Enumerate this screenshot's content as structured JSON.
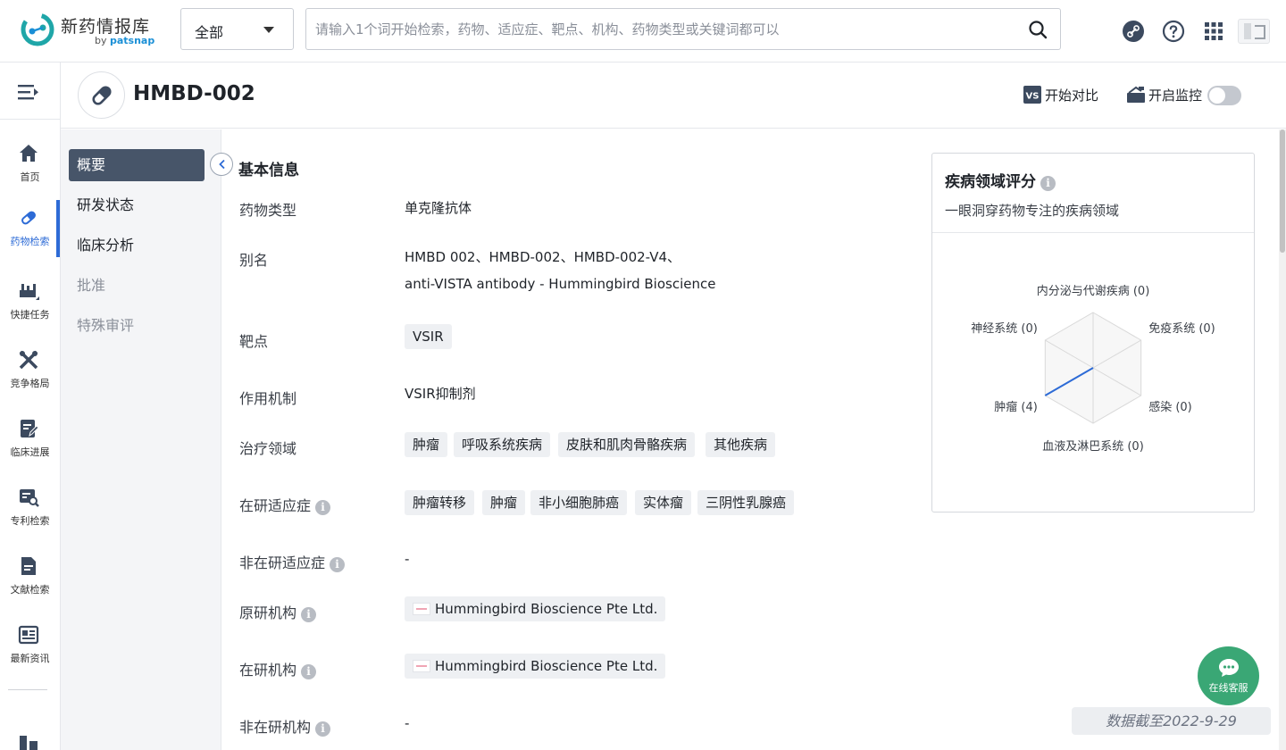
{
  "brand": {
    "title": "新药情报库",
    "sub_prefix": "by",
    "sub_brand": "patsnap"
  },
  "search": {
    "scope": "全部",
    "placeholder": "请输入1个词开始检索，药物、适应症、靶点、机构、药物类型或关键词都可以"
  },
  "sidebar": {
    "items": [
      {
        "label": "首页",
        "icon": "home-icon"
      },
      {
        "label": "药物检索",
        "icon": "pill-icon",
        "active": true
      },
      {
        "label": "快捷任务",
        "icon": "task-icon"
      },
      {
        "label": "竞争格局",
        "icon": "crossed-tools-icon"
      },
      {
        "label": "临床进展",
        "icon": "clipboard-edit-icon"
      },
      {
        "label": "专利检索",
        "icon": "patent-search-icon"
      },
      {
        "label": "文献检索",
        "icon": "document-icon"
      },
      {
        "label": "最新资讯",
        "icon": "news-icon"
      }
    ]
  },
  "header": {
    "drug_name": "HMBD-002",
    "compare_label": "开始对比",
    "monitor_label": "开启监控",
    "monitor_on": false
  },
  "subnav": {
    "items": [
      {
        "label": "概要",
        "state": "active"
      },
      {
        "label": "研发状态",
        "state": "normal"
      },
      {
        "label": "临床分析",
        "state": "normal"
      },
      {
        "label": "批准",
        "state": "disabled"
      },
      {
        "label": "特殊审评",
        "state": "disabled"
      }
    ]
  },
  "basic_info": {
    "title": "基本信息",
    "drug_type": {
      "label": "药物类型",
      "value": "单克隆抗体"
    },
    "alias": {
      "label": "别名",
      "line1": "HMBD 002、HMBD-002、HMBD-002-V4、",
      "line2": "anti-VISTA antibody - Hummingbird Bioscience"
    },
    "target": {
      "label": "靶点",
      "tags": [
        "VSIR"
      ]
    },
    "mechanism": {
      "label": "作用机制",
      "value": "VSIR抑制剂"
    },
    "therapeutic_area": {
      "label": "治疗领域",
      "tags": [
        "肿瘤",
        "呼吸系统疾病",
        "皮肤和肌肉骨骼疾病",
        "其他疾病"
      ]
    },
    "active_indications": {
      "label": "在研适应症",
      "tags": [
        "肿瘤转移",
        "肿瘤",
        "非小细胞肺癌",
        "实体瘤",
        "三阴性乳腺癌"
      ]
    },
    "inactive_indications": {
      "label": "非在研适应症",
      "value": "-"
    },
    "originator": {
      "label": "原研机构",
      "org": "Hummingbird Bioscience Pte Ltd."
    },
    "active_org": {
      "label": "在研机构",
      "org": "Hummingbird Bioscience Pte Ltd."
    },
    "inactive_org": {
      "label": "非在研机构",
      "value": "-"
    }
  },
  "radar": {
    "title": "疾病领域评分",
    "subtitle": "一眼洞穿药物专注的疾病领域",
    "axes": [
      {
        "name": "内分泌与代谢疾病",
        "value": 0,
        "display": "内分泌与代谢疾病 (0)"
      },
      {
        "name": "免疫系统",
        "value": 0,
        "display": "免疫系统 (0)"
      },
      {
        "name": "感染",
        "value": 0,
        "display": "感染 (0)"
      },
      {
        "name": "血液及淋巴系统",
        "value": 0,
        "display": "血液及淋巴系统 (0)"
      },
      {
        "name": "肿瘤",
        "value": 4,
        "display": "肿瘤 (4)"
      },
      {
        "name": "神经系统",
        "value": 0,
        "display": "神经系统 (0)"
      }
    ],
    "max": 4,
    "line_color": "#2d6bd6"
  },
  "chat": {
    "label": "在线客服"
  },
  "data_date": "数据截至2022-9-29"
}
